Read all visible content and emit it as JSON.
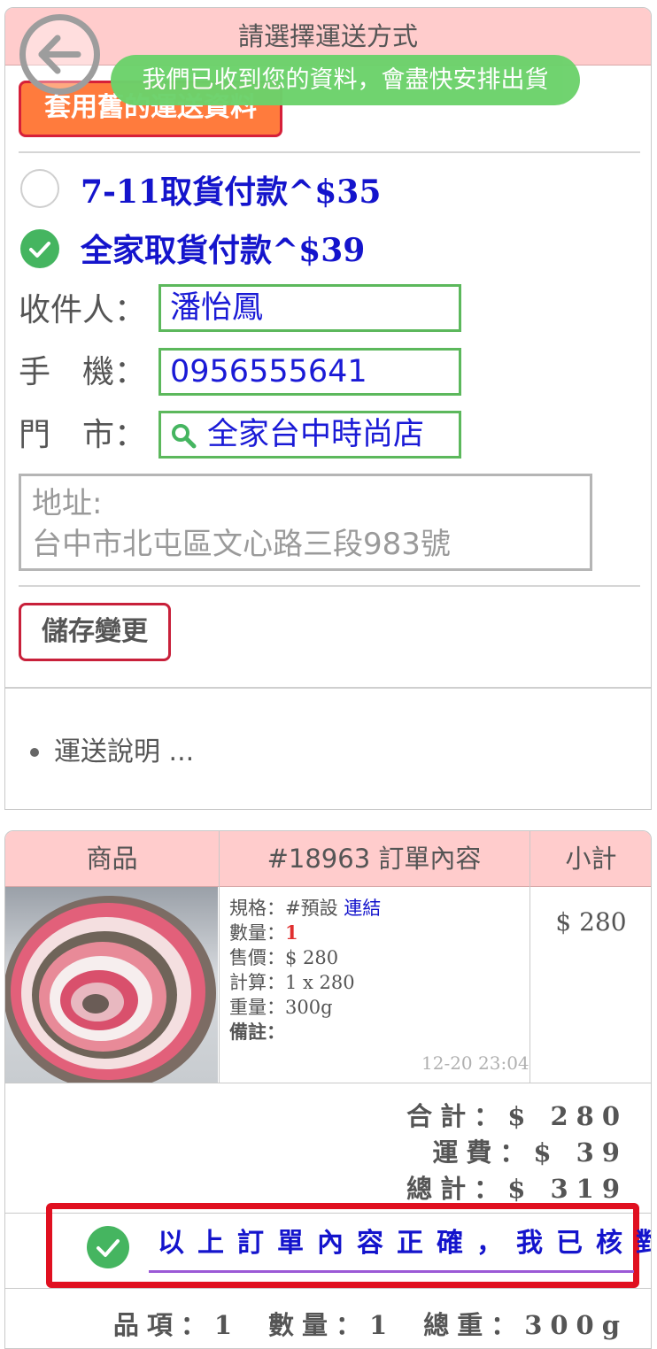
{
  "shipping": {
    "header": "請選擇運送方式",
    "use_previous_label": "套用舊的運送資料",
    "toast": "我們已收到您的資料，會盡快安排出貨",
    "options": [
      {
        "label": "7-11取貨付款^$35",
        "selected": false
      },
      {
        "label": "全家取貨付款^$39",
        "selected": true
      }
    ],
    "fields": {
      "recipient_label": "收件人：",
      "recipient_value": "潘怡鳳",
      "phone_label": "手　機：",
      "phone_value": "0956555641",
      "store_label": "門　市：",
      "store_value": "全家台中時尚店"
    },
    "address_label": "地址:",
    "address_value": "台中市北屯區文心路三段983號",
    "save_label": "儲存變更",
    "note": "運送說明 ..."
  },
  "order": {
    "col_product": "商品",
    "col_content": "#18963 訂單內容",
    "col_subtotal": "小計",
    "item": {
      "spec_label": "規格：",
      "spec_value": "#預設",
      "spec_link": "連結",
      "qty_label": "數量：",
      "qty_value": "1",
      "price_label": "售價：",
      "price_value": "$ 280",
      "calc_label": "計算：",
      "calc_value": "1 x 280",
      "weight_label": "重量：",
      "weight_value": "300g",
      "remark_label": "備註：",
      "time": "12-20 23:04",
      "subtotal": "$ 280"
    },
    "summary": {
      "total_label": "合計：",
      "total_value": "$ 280",
      "shipping_label": "運費：",
      "shipping_value": "$ 39",
      "grand_label": "總計：",
      "grand_value": "$ 319"
    },
    "confirm_label": "以上訂單內容正確，我已核對",
    "confirm_checked": true,
    "stats": {
      "items": "品項：1",
      "quantity": "數量：1",
      "weight": "總重：300g"
    }
  },
  "colors": {
    "header_bg": "#ffcccc",
    "accent_blue": "#1414cc",
    "check_green": "#45b560",
    "toast_green": "#6cd26b",
    "warning_red": "#e01020",
    "orange_button": "#ff7b3d"
  }
}
